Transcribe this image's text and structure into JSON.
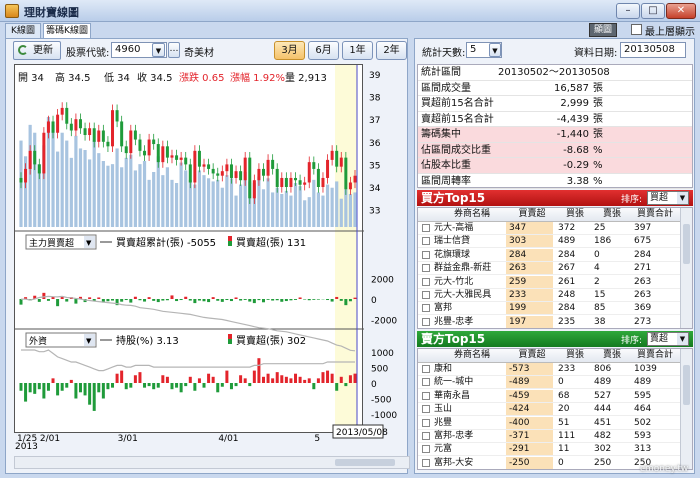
{
  "window": {
    "title": "理財寶線圖",
    "btn_gray": "顯圖",
    "always_on_top": "最上層顯示",
    "min": "–",
    "max": "□",
    "close": "✕"
  },
  "tabs": [
    "K線圖",
    "籌碼K線圖"
  ],
  "toolbar": {
    "refresh": "更新",
    "code_label": "股票代號:",
    "code": "4960",
    "code_more": "…",
    "stock_name": "奇美材",
    "ranges": [
      "3月",
      "6月",
      "1年",
      "2年"
    ],
    "active_range": "3月"
  },
  "chart_data": [
    {
      "type": "candlestick",
      "price_ticks": [
        39,
        38,
        37,
        36,
        35,
        34,
        33
      ],
      "info": {
        "open": "開 34",
        "high": "高 34.5",
        "low": "低 34",
        "close": "收 34.5",
        "change": "漲跌 0.65",
        "change_pct": "漲幅 1.92%",
        "volume": "量 2,913"
      },
      "closes": [
        34.2,
        34.8,
        35.6,
        35.0,
        34.6,
        36.4,
        36.9,
        36.4,
        37.2,
        37.5,
        36.8,
        36.5,
        37.0,
        36.6,
        36.3,
        36.6,
        36.0,
        36.5,
        36.0,
        35.8,
        37.4,
        36.9,
        35.8,
        35.5,
        36.5,
        36.1,
        35.6,
        35.4,
        36.1,
        35.9,
        35.1,
        35.8,
        35.3,
        35.4,
        35.2,
        35.3,
        35.0,
        34.2,
        35.6,
        34.9,
        35.0,
        34.8,
        34.6,
        34.5,
        34.7,
        35.0,
        34.4,
        34.7,
        34.3,
        35.3,
        33.5,
        34.3,
        34.8,
        34.5,
        35.2,
        34.8,
        34.0,
        34.4,
        34.0,
        34.4,
        34.3,
        34.1,
        34.2,
        35.1,
        34.8,
        34.0,
        34.4,
        35.2,
        35.6,
        34.9,
        35.3,
        33.9,
        34.2,
        34.5
      ],
      "volumes": [
        55,
        45,
        65,
        60,
        40,
        52,
        70,
        65,
        48,
        60,
        55,
        44,
        58,
        50,
        49,
        43,
        55,
        47,
        42,
        39,
        40,
        50,
        38,
        44,
        46,
        36,
        40,
        42,
        30,
        35,
        45,
        33,
        38,
        30,
        28,
        41,
        36,
        30,
        27,
        36,
        33,
        31,
        29,
        30,
        25,
        33,
        31,
        20,
        27,
        35,
        29,
        28,
        32,
        24,
        31,
        22,
        25,
        21,
        23,
        20,
        28,
        26,
        17,
        19,
        30,
        22,
        20,
        27,
        25,
        29,
        18,
        24,
        21,
        22
      ]
    },
    {
      "type": "bar",
      "legend_select": "主力買賣超",
      "legend_line": "買賣超累計(張) -5055",
      "legend_bar": "買賣超(張) 131",
      "ticks": [
        2000,
        0,
        -2000
      ],
      "values": [
        -550,
        180,
        -150,
        320,
        -280,
        600,
        -180,
        250,
        -700,
        260,
        -250,
        180,
        -450,
        210,
        -300,
        160,
        -200,
        150,
        -350,
        -220,
        -150,
        -600,
        -260,
        -100,
        -350,
        220,
        -120,
        -250,
        180,
        -180,
        -300,
        -150,
        -120,
        350,
        -200,
        -100,
        220,
        -150,
        -400,
        -150,
        -220,
        -300,
        180,
        -170,
        -280,
        -100,
        -200,
        150,
        -150,
        -90,
        -250,
        -400,
        -110,
        -320,
        -80,
        -150,
        -120,
        -270,
        -200,
        -130,
        -90,
        150,
        -50,
        -120,
        -80,
        -60,
        -30,
        -100,
        -250,
        200,
        -180,
        -600,
        -220,
        131
      ],
      "cumulative": [
        -20,
        -10,
        -100,
        0,
        150,
        200,
        250,
        220,
        200,
        250,
        150,
        120,
        50,
        0,
        -100,
        -150,
        -200,
        -250,
        -300,
        -350,
        -400,
        -450,
        -550,
        -600,
        -620,
        -700,
        -850,
        -900,
        -950,
        -1000,
        -1100,
        -1200,
        -1250,
        -1300,
        -1350,
        -1400,
        -1450,
        -1500,
        -1600,
        -1700,
        -1800,
        -1850,
        -1900,
        -1950,
        -2000,
        -2100,
        -2200,
        -2300,
        -2400,
        -2500,
        -2600,
        -2700,
        -2800,
        -2850,
        -2900,
        -3000,
        -3100,
        -3150,
        -3200,
        -3300,
        -3400,
        -3500,
        -3600,
        -3700,
        -3800,
        -3900,
        -4000,
        -4100,
        -4300,
        -4500,
        -4600,
        -4800,
        -5000,
        -5055
      ]
    },
    {
      "type": "bar",
      "legend_select": "外資",
      "legend_line": "持股(%) 3.13",
      "legend_bar": "買賣超(張) 302",
      "ticks": [
        1000,
        500,
        0,
        -500,
        -1000
      ],
      "values": [
        -250,
        -600,
        -300,
        -350,
        -200,
        -500,
        -250,
        150,
        -400,
        -250,
        -150,
        100,
        -500,
        -300,
        -400,
        -700,
        -900,
        -300,
        -500,
        -200,
        -150,
        300,
        400,
        -200,
        -150,
        250,
        350,
        -150,
        -100,
        -200,
        -150,
        250,
        200,
        -200,
        -150,
        -300,
        -100,
        200,
        -250,
        150,
        -150,
        300,
        200,
        -300,
        -120,
        400,
        -200,
        -100,
        250,
        150,
        -100,
        400,
        800,
        200,
        300,
        150,
        350,
        250,
        200,
        150,
        300,
        200,
        100,
        150,
        -200,
        150,
        350,
        400,
        300,
        -250,
        200,
        -100,
        250,
        302
      ],
      "holding": [
        3.2,
        3.2,
        3.2,
        3.2,
        3.19,
        3.19,
        3.2,
        3.18,
        3.16,
        3.15,
        3.14,
        3.13,
        3.13,
        3.12,
        3.11,
        3.1,
        3.09,
        3.08,
        3.08,
        3.09,
        3.1,
        3.11,
        3.11,
        3.1,
        3.1,
        3.11,
        3.11,
        3.11,
        3.11,
        3.1,
        3.1,
        3.1,
        3.1,
        3.1,
        3.1,
        3.1,
        3.1,
        3.1,
        3.1,
        3.1,
        3.1,
        3.1,
        3.1,
        3.1,
        3.1,
        3.1,
        3.1,
        3.1,
        3.1,
        3.1,
        3.1,
        3.11,
        3.11,
        3.12,
        3.12,
        3.12,
        3.12,
        3.12,
        3.12,
        3.12,
        3.12,
        3.12,
        3.12,
        3.12,
        3.12,
        3.12,
        3.12,
        3.13,
        3.13,
        3.13,
        3.13,
        3.13,
        3.13,
        3.13
      ]
    }
  ],
  "x_labels": [
    {
      "t": "1/25",
      "i": 0
    },
    {
      "t": "2/01",
      "i": 5
    },
    {
      "t": "3/01",
      "i": 22
    },
    {
      "t": "4/01",
      "i": 44
    },
    {
      "t": "5",
      "i": 65
    }
  ],
  "year_label": "2013",
  "tooltip_date": "2013/05/08",
  "stats_controls": {
    "days_label": "統計天數:",
    "days": "5",
    "date_label": "資料日期:",
    "date": "20130508"
  },
  "stats": [
    {
      "k": "統計區間",
      "v": "20130502～20130508",
      "u": "",
      "hl": false
    },
    {
      "k": "區間成交量",
      "v": "16,587",
      "u": "張",
      "hl": false
    },
    {
      "k": "買超前15名合計",
      "v": "2,999",
      "u": "張",
      "hl": false
    },
    {
      "k": "賣超前15名合計",
      "v": "-4,439",
      "u": "張",
      "hl": false
    },
    {
      "k": "籌碼集中",
      "v": "-1,440",
      "u": "張",
      "hl": true
    },
    {
      "k": "佔區間成交比重",
      "v": "-8.68",
      "u": "%",
      "hl": true
    },
    {
      "k": "佔股本比重",
      "v": "-0.29",
      "u": "%",
      "hl": true
    },
    {
      "k": "區間周轉率",
      "v": "3.38",
      "u": "%",
      "hl": false
    }
  ],
  "buy": {
    "title": "買方Top15",
    "sort_label": "排序:",
    "sort": "買超",
    "headers": [
      "券商名稱",
      "買賣超",
      "買張",
      "賣張",
      "買賣合計"
    ],
    "rows": [
      [
        "元大-高福",
        "347",
        "372",
        "25",
        "397"
      ],
      [
        "瑞士信貸",
        "303",
        "489",
        "186",
        "675"
      ],
      [
        "花旗環球",
        "284",
        "284",
        "0",
        "284"
      ],
      [
        "群益金鼎-新莊",
        "263",
        "267",
        "4",
        "271"
      ],
      [
        "元大-竹北",
        "259",
        "261",
        "2",
        "263"
      ],
      [
        "元大-大雅民具",
        "233",
        "248",
        "15",
        "263"
      ],
      [
        "富邦",
        "199",
        "284",
        "85",
        "369"
      ],
      [
        "兆豐-忠孝",
        "197",
        "235",
        "38",
        "273"
      ]
    ]
  },
  "sell": {
    "title": "賣方Top15",
    "sort_label": "排序:",
    "sort": "賣超",
    "headers": [
      "券商名稱",
      "買賣超",
      "買張",
      "賣張",
      "買賣合計"
    ],
    "rows": [
      [
        "康和",
        "-573",
        "233",
        "806",
        "1039"
      ],
      [
        "統一-城中",
        "-489",
        "0",
        "489",
        "489"
      ],
      [
        "華南永昌",
        "-459",
        "68",
        "527",
        "595"
      ],
      [
        "玉山",
        "-424",
        "20",
        "444",
        "464"
      ],
      [
        "兆豐",
        "-400",
        "51",
        "451",
        "502"
      ],
      [
        "富邦-忠孝",
        "-371",
        "111",
        "482",
        "593"
      ],
      [
        "元富",
        "-291",
        "11",
        "302",
        "313"
      ],
      [
        "富邦-大安",
        "-250",
        "0",
        "250",
        "250"
      ]
    ]
  },
  "watermark": "cmoney.tw",
  "colors": {
    "up": "#e3242b",
    "down": "#1f9b3a",
    "vol": "#a8c4e0",
    "line": "#b5b5b5",
    "highlight": "#fbe1b8"
  }
}
